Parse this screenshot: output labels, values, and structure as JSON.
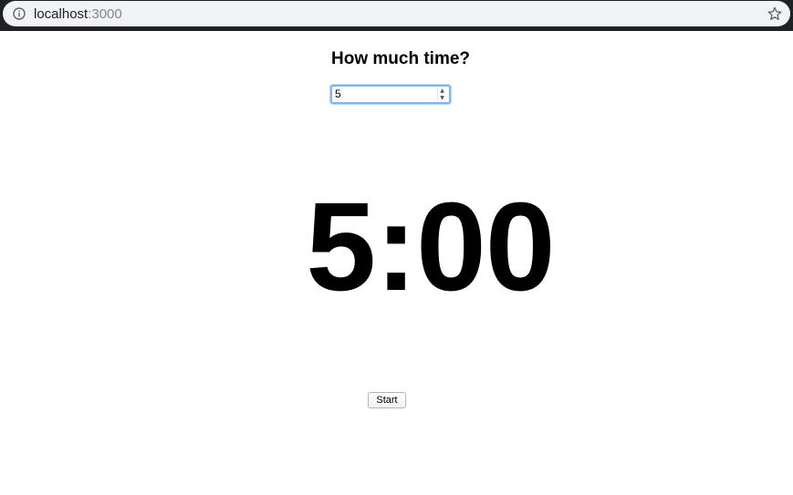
{
  "browser": {
    "url_host": "localhost",
    "url_port": ":3000",
    "info_icon": "info-icon",
    "bookmark_icon": "star-icon"
  },
  "page": {
    "heading": "How much time?",
    "minutes_input": {
      "value": "5"
    },
    "timer_display": "5:00",
    "start_button_label": "Start"
  }
}
